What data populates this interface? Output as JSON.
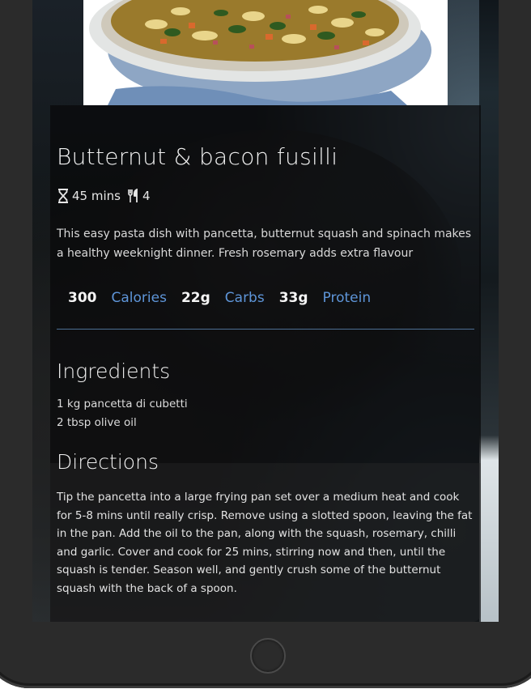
{
  "recipe": {
    "title": "Butternut & bacon fusilli",
    "time": "45 mins",
    "servings": "4",
    "description": "This easy pasta dish with pancetta, butternut squash and spinach makes a healthy weeknight dinner. Fresh rosemary adds extra flavour",
    "nutrition": [
      {
        "value": "300",
        "label": "Calories"
      },
      {
        "value": "22g",
        "label": "Carbs"
      },
      {
        "value": "33g",
        "label": "Protein"
      }
    ],
    "ingredients_heading": "Ingredients",
    "ingredients": [
      "1 kg pancetta di cubetti",
      "2 tbsp olive oil"
    ],
    "directions_heading": "Directions",
    "directions": "Tip the pancetta into a large frying pan set over a medium heat and cook for 5-8 mins until really crisp. Remove using a slotted spoon, leaving the fat in the pan. Add the oil to the pan, along with the squash, rosemary, chilli and garlic. Cover and cook for 25 mins, stirring now and then, until the squash is tender. Season well, and gently crush some of the butternut squash with the back of a spoon."
  },
  "icons": {
    "time": "hourglass-icon",
    "servings": "cutlery-icon",
    "home": "home-button"
  },
  "colors": {
    "accent": "#5e95d8",
    "divider": "#4d6f94",
    "card_bg": "#08090a"
  }
}
